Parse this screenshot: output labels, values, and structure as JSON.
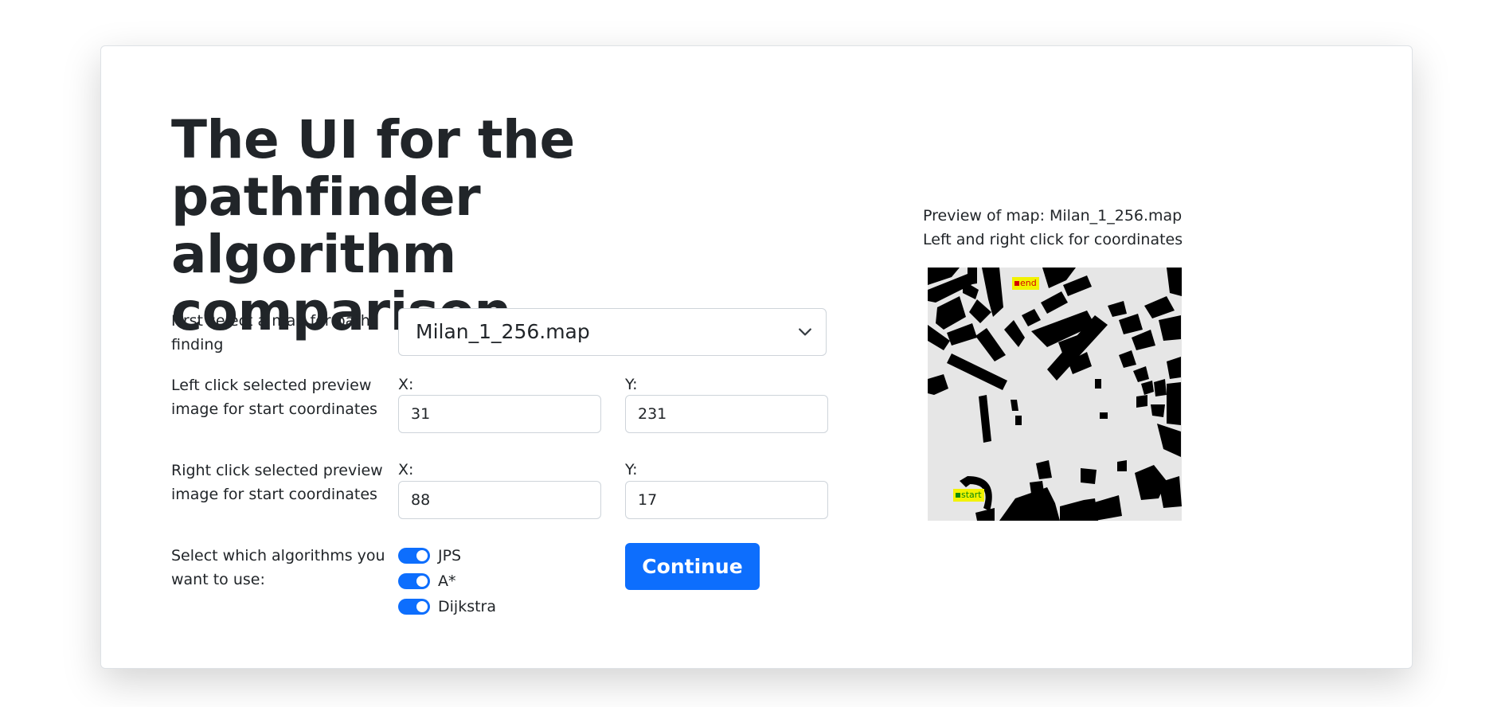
{
  "header": {
    "title": "The UI for the pathfinder algorithm comparison"
  },
  "form": {
    "map_select": {
      "label": "First select a map for path finding",
      "value": "Milan_1_256.map"
    },
    "start_coords": {
      "label": "Left click selected preview image for start coordinates",
      "x_label": "X:",
      "x_value": "31",
      "y_label": "Y:",
      "y_value": "231"
    },
    "end_coords": {
      "label": "Right click selected preview image for start coordinates",
      "x_label": "X:",
      "x_value": "88",
      "y_label": "Y:",
      "y_value": "17"
    },
    "algorithms": {
      "label": "Select which algorithms you want to use:",
      "options": [
        {
          "label": "JPS",
          "checked": true
        },
        {
          "label": "A*",
          "checked": true
        },
        {
          "label": "Dijkstra",
          "checked": true
        }
      ]
    },
    "continue_label": "Continue"
  },
  "preview": {
    "title": "Preview of map: Milan_1_256.map",
    "hint": "Left and right click for coordinates",
    "end_marker": "end",
    "start_marker": "start"
  },
  "colors": {
    "accent": "#0d6efd",
    "map_floor": "#e6e6e6",
    "map_wall": "#000000",
    "marker_bg": "#f2f200",
    "end_square": "#d40000",
    "start_square": "#0a8a0a"
  }
}
